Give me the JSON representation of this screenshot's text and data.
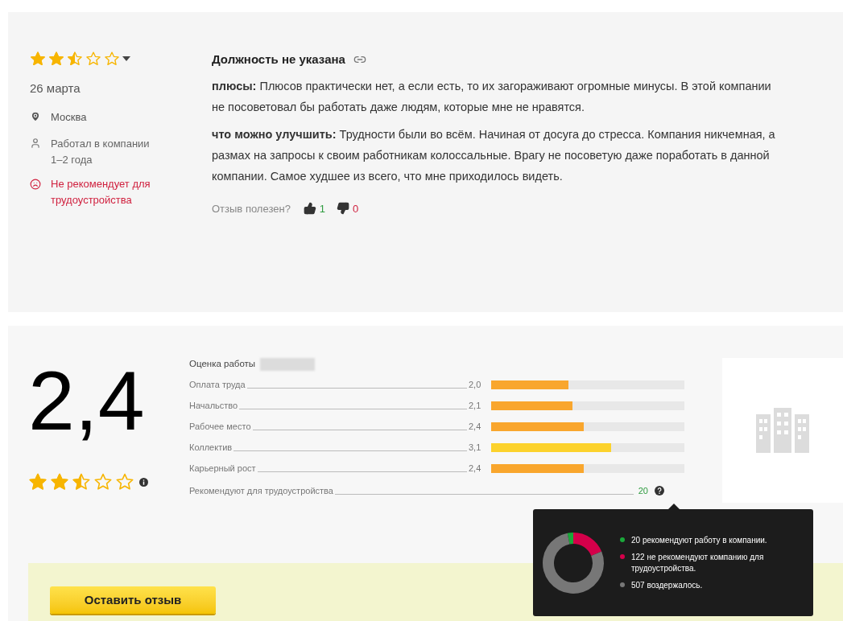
{
  "review": {
    "stars": 2.5,
    "date": "26 марта",
    "city": "Москва",
    "tenure": "Работал в компании 1–2 года",
    "recommendation": {
      "recommends": false,
      "label": "Не рекомендует для трудоустройства"
    },
    "position": "Должность не указана",
    "sections": [
      {
        "text": "**плюсы:** Плюсов практически нет, а если есть, то их загораживают огромные минусы. В этой компании не посоветовал бы работать даже людям, которые мне не нравятся."
      },
      {
        "text": "**что можно улучшить:** Трудности были во всём. Начиная от досуга до стресса. Компания никчемная, а размах на запросы к своим работникам колоссальные. Врагу не посоветую даже поработать в данной компании. Самое худшее из всего, что мне приходилось видеть."
      }
    ],
    "helpful": {
      "question": "Отзыв полезен?",
      "likes": "1",
      "dislikes": "0"
    }
  },
  "summary": {
    "score": "2,4",
    "stars": 2.5,
    "ratings_title": "Оценка работы",
    "ratings": [
      {
        "name": "Оплата труда",
        "value": "2,0",
        "level": 0.4,
        "color": "#f9a62d"
      },
      {
        "name": "Начальство",
        "value": "2,1",
        "level": 0.42,
        "color": "#f9a62d"
      },
      {
        "name": "Рабочее место",
        "value": "2,4",
        "level": 0.48,
        "color": "#f9a62d"
      },
      {
        "name": "Коллектив",
        "value": "3,1",
        "level": 0.62,
        "color": "#fcd22c"
      },
      {
        "name": "Карьерный рост",
        "value": "2,4",
        "level": 0.48,
        "color": "#f9a62d"
      }
    ],
    "recommend": {
      "label": "Рекомендуют для трудоустройства",
      "value": "20"
    }
  },
  "tooltip": {
    "chart_data": {
      "type": "donut",
      "values": [
        3.08,
        18.8,
        78.12
      ]
    },
    "legend": [
      {
        "text": "20 рекомендуют работу в компании.",
        "color": "#1aa83a"
      },
      {
        "text": "122 не рекомендуют компанию для трудоустройства.",
        "color": "#d4004a"
      },
      {
        "text": "507 воздержалось.",
        "color": "#777777"
      }
    ]
  },
  "leave_review_button": "Оставить отзыв"
}
